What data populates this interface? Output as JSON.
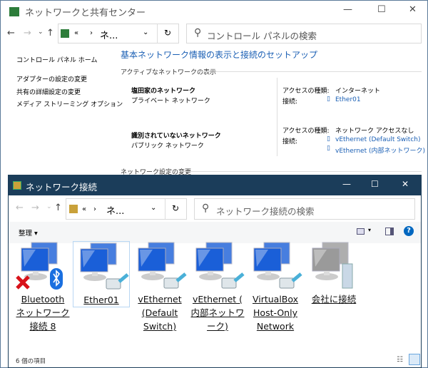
{
  "back_window": {
    "title": "ネットワークと共有センター",
    "address": {
      "crumb_prefix": "«",
      "crumb_sep": "›",
      "crumb": "ネ..."
    },
    "search_placeholder": "コントロール パネルの検索",
    "sidebar": {
      "home": "コントロール パネル ホーム",
      "items": [
        "アダプターの設定の変更",
        "共有の詳細設定の変更",
        "メディア ストリーミング オプション"
      ]
    },
    "heading": "基本ネットワーク情報の表示と接続のセットアップ",
    "active_section": "アクティブなネットワークの表示",
    "networks": [
      {
        "name": "塩田家のネットワーク",
        "type": "プライベート ネットワーク",
        "access_label": "アクセスの種類:",
        "access": "インターネット",
        "conn_label": "接続:",
        "connections": [
          "Ether01"
        ]
      },
      {
        "name": "識別されていないネットワーク",
        "type": "パブリック ネットワーク",
        "access_label": "アクセスの種類:",
        "access": "ネットワーク アクセスなし",
        "conn_label": "接続:",
        "connections": [
          "vEthernet (Default Switch)",
          "vEthernet (内部ネットワーク)"
        ]
      }
    ],
    "change_section": "ネットワーク設定の変更"
  },
  "front_window": {
    "title": "ネットワーク接続",
    "address": {
      "crumb_prefix": "«",
      "crumb_sep": "› ",
      "crumb": "ネ..."
    },
    "search_placeholder": "ネットワーク接続の検索",
    "organize": "整理 ▾",
    "items": [
      {
        "lines": [
          "Bluetooth",
          "ネットワーク",
          "接続 8"
        ],
        "icon": "bluetooth-disconnected"
      },
      {
        "lines": [
          "Ether01"
        ],
        "icon": "ethernet"
      },
      {
        "lines": [
          "vEthernet",
          "(Default",
          "Switch)"
        ],
        "icon": "ethernet"
      },
      {
        "lines": [
          "vEthernet (",
          "内部ネットワ",
          "ーク)"
        ],
        "icon": "ethernet"
      },
      {
        "lines": [
          "VirtualBox",
          "Host-Only",
          "Network"
        ],
        "icon": "ethernet"
      },
      {
        "lines": [
          "会社に接続"
        ],
        "icon": "vpn"
      }
    ],
    "status": "6 個の項目"
  },
  "colors": {
    "titlebar": "#1b3d5a",
    "link": "#1a5fb4",
    "accent": "#0067c0"
  }
}
